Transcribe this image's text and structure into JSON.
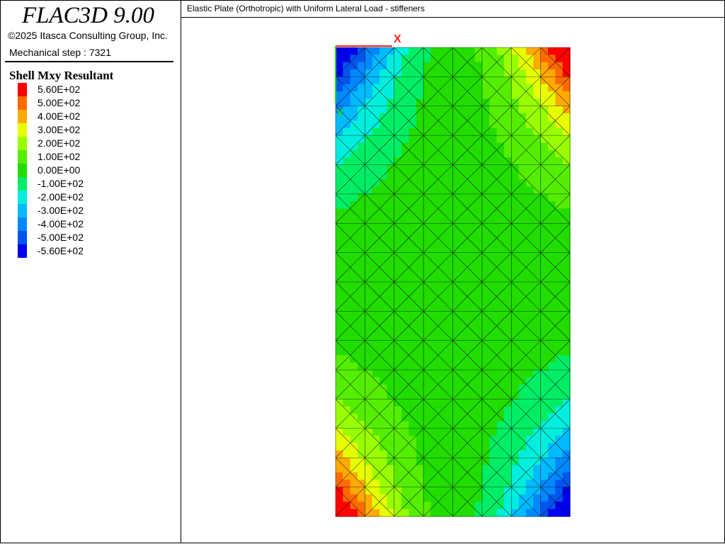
{
  "app": {
    "title": "FLAC3D 9.00",
    "copyright": "©2025 Itasca Consulting Group, Inc.",
    "step": "Mechanical step : 7321"
  },
  "legend": {
    "title": "Shell Mxy Resultant",
    "entries": [
      {
        "label": "5.60E+02",
        "color": "#ff0000"
      },
      {
        "label": "5.00E+02",
        "color": "#ff6a00"
      },
      {
        "label": "4.00E+02",
        "color": "#ffaa00"
      },
      {
        "label": "3.00E+02",
        "color": "#e6ff00"
      },
      {
        "label": "2.00E+02",
        "color": "#99ff00"
      },
      {
        "label": "1.00E+02",
        "color": "#55ee00"
      },
      {
        "label": "0.00E+00",
        "color": "#22dd00"
      },
      {
        "label": "-1.00E+02",
        "color": "#00ee66"
      },
      {
        "label": "-2.00E+02",
        "color": "#00eedd"
      },
      {
        "label": "-3.00E+02",
        "color": "#00bbff"
      },
      {
        "label": "-4.00E+02",
        "color": "#0088ff"
      },
      {
        "label": "-5.00E+02",
        "color": "#0055ee"
      },
      {
        "label": "-5.60E+02",
        "color": "#0000ee"
      }
    ]
  },
  "view": {
    "title": "Elastic Plate (Orthotropic) with Uniform Lateral Load - stiffeners",
    "axes": {
      "x_label": "X",
      "y_label": "Y",
      "x_color": "#ff2222",
      "y_color": "#22dd22"
    }
  },
  "contour": {
    "description_colors_low_to_high": [
      "#0000ee",
      "#0055ee",
      "#0088ff",
      "#00bbff",
      "#00eedd",
      "#00ee66",
      "#22dd00",
      "#55ee00",
      "#99ff00",
      "#e6ff00",
      "#ffaa00",
      "#ff6a00",
      "#ff0000"
    ],
    "value_min": -560,
    "value_max": 560,
    "mesh": {
      "columns": 8,
      "rows": 16
    }
  }
}
